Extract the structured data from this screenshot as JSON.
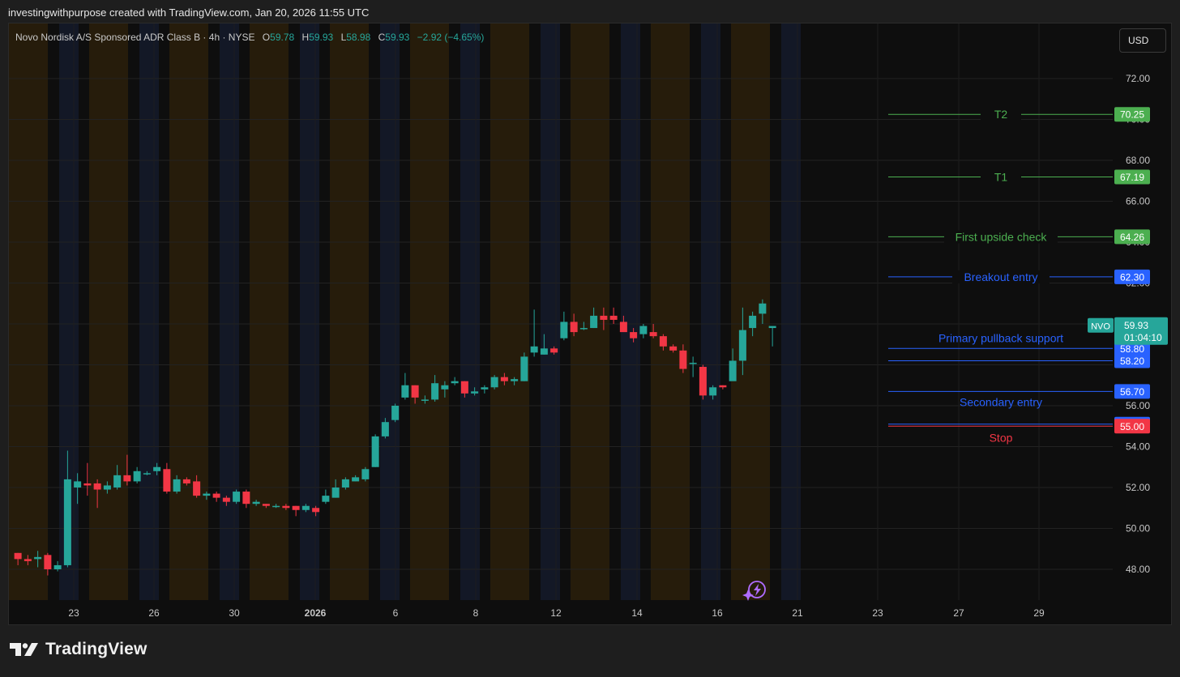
{
  "header": {
    "attribution": "investingwithpurpose created with TradingView.com, Jan 20, 2026 11:55 UTC"
  },
  "legend": {
    "symbol_line": "Novo Nordisk A/S Sponsored ADR Class B · 4h · NYSE",
    "o_label": "O",
    "o_value": "59.78",
    "h_label": "H",
    "h_value": "59.93",
    "l_label": "L",
    "l_value": "58.98",
    "c_label": "C",
    "c_value": "59.93",
    "change": "−2.92 (−4.65%)"
  },
  "currency_button": "USD",
  "brand": {
    "name": "TradingView"
  },
  "colors": {
    "up": "#26a69a",
    "down": "#f23645",
    "target": "#4caf50",
    "entry": "#2962ff",
    "stop": "#f23645",
    "session_pre": "#2a1e0a",
    "session_post": "#141a2a"
  },
  "icons": {
    "replay": "lightning-bolt-icon",
    "logo": "tradingview-logo-icon"
  },
  "chart_data": {
    "type": "candlestick",
    "symbol": "NVO",
    "interval": "4h",
    "y_axis": {
      "ticks": [
        "48.00",
        "50.00",
        "52.00",
        "54.00",
        "56.00",
        "58.00",
        "60.00",
        "62.00",
        "64.00",
        "66.00",
        "68.00",
        "70.00",
        "72.00"
      ],
      "range": [
        46.5,
        74.0
      ]
    },
    "x_axis": {
      "ticks": [
        "23",
        "26",
        "30",
        "2026",
        "6",
        "8",
        "12",
        "14",
        "16",
        "21",
        "23",
        "27",
        "29"
      ]
    },
    "candles": [
      [
        48.8,
        48.5,
        48.2,
        48.8
      ],
      [
        48.5,
        48.4,
        48.2,
        48.7
      ],
      [
        48.5,
        48.6,
        48.1,
        48.9
      ],
      [
        48.7,
        48.0,
        47.7,
        48.8
      ],
      [
        48.0,
        48.2,
        47.9,
        48.4
      ],
      [
        48.2,
        52.4,
        48.1,
        53.8
      ],
      [
        52.0,
        52.3,
        51.2,
        52.7
      ],
      [
        52.2,
        52.1,
        51.6,
        53.2
      ],
      [
        52.2,
        51.9,
        51.0,
        52.4
      ],
      [
        51.9,
        52.1,
        51.7,
        52.3
      ],
      [
        52.0,
        52.6,
        51.9,
        53.1
      ],
      [
        52.6,
        52.3,
        52.1,
        53.6
      ],
      [
        52.3,
        52.8,
        52.2,
        53.0
      ],
      [
        52.7,
        52.7,
        52.6,
        52.8
      ],
      [
        52.8,
        53.0,
        52.6,
        53.2
      ],
      [
        52.9,
        51.8,
        51.7,
        53.2
      ],
      [
        51.8,
        52.4,
        51.7,
        52.6
      ],
      [
        52.4,
        52.2,
        52.1,
        52.5
      ],
      [
        52.3,
        51.6,
        51.5,
        52.6
      ],
      [
        51.6,
        51.7,
        51.4,
        51.8
      ],
      [
        51.7,
        51.5,
        51.3,
        51.8
      ],
      [
        51.5,
        51.3,
        51.1,
        51.6
      ],
      [
        51.3,
        51.8,
        51.2,
        51.9
      ],
      [
        51.8,
        51.2,
        51.0,
        51.9
      ],
      [
        51.2,
        51.3,
        51.1,
        51.4
      ],
      [
        51.2,
        51.1,
        51.0,
        51.2
      ],
      [
        51.1,
        51.1,
        51.0,
        51.2
      ],
      [
        51.1,
        51.0,
        50.9,
        51.2
      ],
      [
        51.1,
        50.9,
        50.6,
        51.1
      ],
      [
        50.9,
        51.1,
        50.8,
        51.2
      ],
      [
        51.0,
        50.8,
        50.6,
        51.1
      ],
      [
        51.3,
        51.6,
        51.2,
        51.9
      ],
      [
        51.5,
        52.0,
        51.5,
        52.4
      ],
      [
        52.0,
        52.4,
        51.9,
        52.5
      ],
      [
        52.3,
        52.5,
        52.3,
        52.6
      ],
      [
        52.4,
        52.9,
        52.3,
        53.0
      ],
      [
        53.0,
        54.5,
        53.0,
        54.6
      ],
      [
        54.5,
        55.2,
        54.4,
        55.4
      ],
      [
        55.3,
        56.0,
        55.2,
        56.1
      ],
      [
        56.4,
        57.0,
        56.3,
        57.6
      ],
      [
        57.0,
        56.4,
        56.1,
        57.0
      ],
      [
        56.3,
        56.3,
        56.1,
        56.5
      ],
      [
        56.3,
        57.1,
        56.2,
        57.5
      ],
      [
        56.8,
        57.0,
        56.4,
        57.2
      ],
      [
        57.1,
        57.2,
        57.0,
        57.4
      ],
      [
        57.2,
        56.6,
        56.4,
        57.2
      ],
      [
        56.6,
        56.7,
        56.5,
        56.9
      ],
      [
        56.8,
        56.9,
        56.6,
        57.0
      ],
      [
        56.9,
        57.4,
        56.8,
        57.5
      ],
      [
        57.4,
        57.2,
        57.0,
        57.6
      ],
      [
        57.2,
        57.3,
        57.0,
        57.4
      ],
      [
        57.2,
        58.4,
        57.2,
        58.6
      ],
      [
        58.6,
        58.9,
        58.4,
        60.7
      ],
      [
        58.5,
        58.8,
        58.5,
        59.5
      ],
      [
        58.8,
        58.6,
        58.5,
        58.9
      ],
      [
        59.3,
        60.1,
        59.2,
        60.6
      ],
      [
        60.1,
        59.6,
        59.4,
        60.5
      ],
      [
        59.8,
        59.8,
        59.7,
        60.1
      ],
      [
        59.8,
        60.4,
        59.8,
        60.8
      ],
      [
        60.4,
        60.2,
        59.7,
        60.8
      ],
      [
        60.4,
        60.2,
        60.0,
        60.8
      ],
      [
        60.1,
        59.6,
        59.7,
        60.4
      ],
      [
        59.6,
        59.3,
        59.1,
        59.8
      ],
      [
        59.5,
        59.9,
        59.3,
        60.0
      ],
      [
        59.6,
        59.4,
        59.3,
        60.0
      ],
      [
        59.4,
        58.9,
        58.7,
        59.5
      ],
      [
        58.9,
        58.7,
        58.6,
        59.0
      ],
      [
        58.7,
        57.8,
        57.6,
        59.0
      ],
      [
        58.1,
        58.1,
        57.4,
        58.4
      ],
      [
        57.9,
        56.5,
        56.3,
        58.0
      ],
      [
        56.5,
        56.9,
        56.3,
        57.0
      ],
      [
        57.0,
        56.9,
        56.8,
        57.0
      ],
      [
        57.2,
        58.2,
        57.6,
        58.8
      ],
      [
        58.2,
        59.7,
        57.5,
        60.8
      ],
      [
        59.8,
        60.4,
        59.4,
        60.6
      ],
      [
        60.5,
        61.0,
        60.0,
        61.2
      ],
      [
        59.8,
        59.9,
        58.9,
        59.9
      ]
    ],
    "levels": [
      {
        "label": "T2",
        "value": 70.25,
        "value_label": "70.25",
        "color": "#4caf50"
      },
      {
        "label": "T1",
        "value": 67.19,
        "value_label": "67.19",
        "color": "#4caf50"
      },
      {
        "label": "First upside check",
        "value": 64.26,
        "value_label": "64.26",
        "color": "#4caf50"
      },
      {
        "label": "Breakout entry",
        "value": 62.3,
        "value_label": "62.30",
        "color": "#2962ff"
      },
      {
        "label": "Primary pullback support",
        "value": 58.8,
        "value_label": "58.80",
        "color": "#2962ff"
      },
      {
        "label": "",
        "value": 58.2,
        "value_label": "58.20",
        "color": "#2962ff"
      },
      {
        "label": "Secondary entry",
        "value": 56.7,
        "value_label": "56.70",
        "color": "#2962ff"
      },
      {
        "label": "",
        "value": 55.1,
        "value_label": "55.10",
        "color": "#2962ff"
      },
      {
        "label": "Stop",
        "value": 55.0,
        "value_label": "55.00",
        "color": "#f23645"
      }
    ],
    "last_price": {
      "symbol": "NVO",
      "price": "59.93",
      "countdown": "01:04:10",
      "value": 59.93
    }
  }
}
